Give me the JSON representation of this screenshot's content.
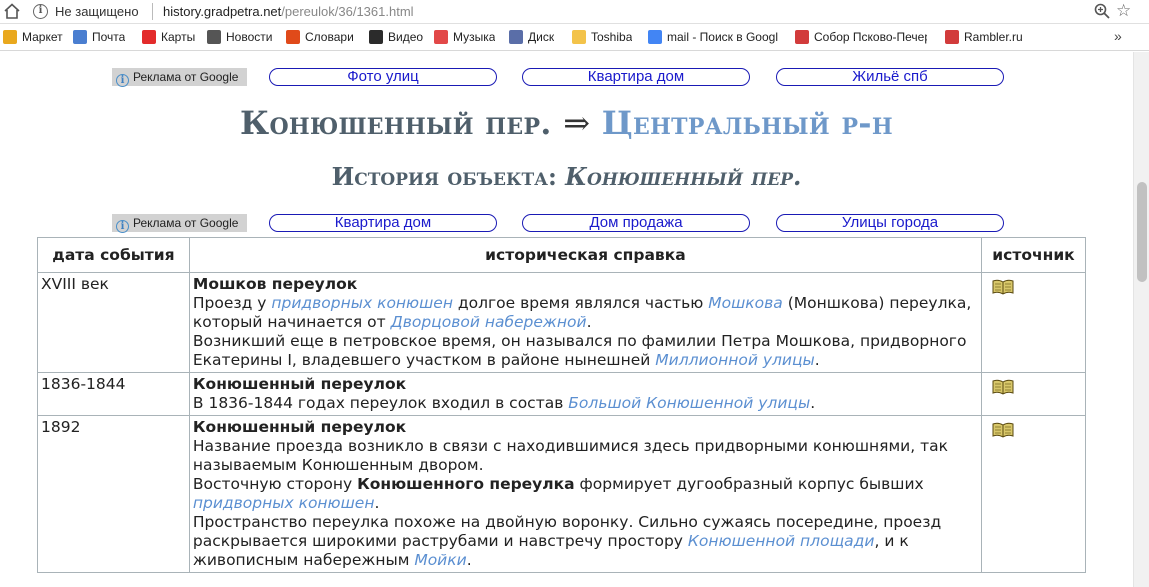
{
  "browser": {
    "security_label": "Не защищено",
    "url_host": "history.gradpetra.net",
    "url_path": "/pereulok/36/1361.html",
    "bookmarks": [
      {
        "label": "Маркет",
        "color": "#e9a81e"
      },
      {
        "label": "Почта",
        "color": "#4a7ed0"
      },
      {
        "label": "Карты",
        "color": "#e32b2b"
      },
      {
        "label": "Новости",
        "color": "#555555"
      },
      {
        "label": "Словари",
        "color": "#e04a1a"
      },
      {
        "label": "Видео",
        "color": "#2b2b2b"
      },
      {
        "label": "Музыка",
        "color": "#e24848"
      },
      {
        "label": "Диск",
        "color": "#5a6ea8"
      },
      {
        "label": "Toshiba",
        "color": "#f3c34a"
      },
      {
        "label": "mail - Поиск в Googl",
        "color": "#4285f4"
      },
      {
        "label": "Собор Псково-Печер",
        "color": "#d23b3b"
      },
      {
        "label": "Rambler.ru",
        "color": "#d23b3b"
      }
    ],
    "more": "»"
  },
  "ads_top": {
    "badge": "Реклама от Google",
    "links": [
      "Фото улиц",
      "Квартира дом",
      "Жильё спб"
    ]
  },
  "heading": {
    "street": "Конюшенный пер.",
    "arrow": "⇒",
    "district": "Центральный р-н"
  },
  "subheading": {
    "label": "История объекта:",
    "object": "Конюшенный пер."
  },
  "ads_mid": {
    "badge": "Реклама от Google",
    "links": [
      "Квартира дом",
      "Дом продажа",
      "Улицы города"
    ]
  },
  "table": {
    "headers": [
      "дата события",
      "историческая справка",
      "источник"
    ],
    "rows": [
      {
        "date": "XVIII век",
        "title": "Мошков переулок",
        "p1": [
          "Проезд у ",
          "придворных конюшен",
          " долгое время являлся частью ",
          "Мошкова",
          " (Моншкова) переулка, который начинается от ",
          "Дворцовой набережной",
          "."
        ],
        "p2": [
          "Возникший еще в петровское время, он назывался по фамилии Петра Мошкова, придворного Екатерины I, владевшего участком в районе нынешней ",
          "Миллионной улицы",
          "."
        ]
      },
      {
        "date": "1836-1844",
        "title": "Конюшенный переулок",
        "p1": [
          "В 1836-1844 годах переулок входил в состав ",
          "Большой Конюшенной улицы",
          "."
        ]
      },
      {
        "date": "1892",
        "title": "Конюшенный переулок",
        "p1": [
          "Название проезда возникло в связи с находившимися здесь придворными конюшнями, так называемым Конюшенным двором."
        ],
        "p2": [
          "Восточную сторону ",
          "Конюшенного переулка",
          " формирует дугообразный корпус бывших ",
          "придворных конюшен",
          "."
        ],
        "p3": [
          "Пространство переулка похоже на двойную воронку. Сильно сужаясь посередине, проезд раскрывается широкими раструбами и навстречу простору ",
          "Конюшенной площади",
          ", и к живописным набережным ",
          "Мойки",
          "."
        ]
      }
    ]
  },
  "colors": {
    "link": "#5b8fd1",
    "heading": "#4f5f6b",
    "district": "#6e98c9",
    "pill_border": "#1a1ab5"
  },
  "icons": {
    "source": "book-icon"
  }
}
